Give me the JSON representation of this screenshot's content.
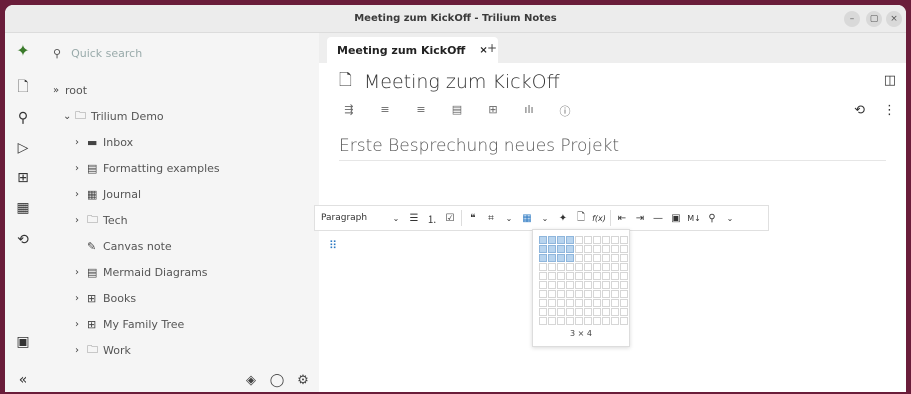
{
  "window": {
    "title": "Meeting zum KickOff - Trilium Notes",
    "controls": {
      "minimize": "–",
      "maximize": "▢",
      "close": "×"
    }
  },
  "launcher": {
    "logo": "✦",
    "new_note": "🗋",
    "search": "⚲",
    "jump": "▷",
    "map": "⊞",
    "calendar": "▦",
    "history": "⟲",
    "today": "▣",
    "collapse": "«"
  },
  "search": {
    "placeholder": "Quick search",
    "icon": "⚲"
  },
  "tree": {
    "root": {
      "label": "root",
      "arrow": "»"
    },
    "items": [
      {
        "label": "Trilium Demo",
        "arrow": "⌄",
        "icon": "🗀"
      },
      {
        "label": "Inbox",
        "arrow": "›",
        "icon": "▬"
      },
      {
        "label": "Formatting examples",
        "arrow": "›",
        "icon": "▤"
      },
      {
        "label": "Journal",
        "arrow": "›",
        "icon": "▦"
      },
      {
        "label": "Tech",
        "arrow": "›",
        "icon": "🗀"
      },
      {
        "label": "Canvas note",
        "arrow": "",
        "icon": "✎"
      },
      {
        "label": "Mermaid Diagrams",
        "arrow": "›",
        "icon": "▤"
      },
      {
        "label": "Books",
        "arrow": "›",
        "icon": "⊞"
      },
      {
        "label": "My Family Tree",
        "arrow": "›",
        "icon": "⊞"
      },
      {
        "label": "Work",
        "arrow": "›",
        "icon": "🗀"
      }
    ],
    "footer": {
      "layers": "◈",
      "sync": "◯",
      "settings": "⚙"
    }
  },
  "tabs": [
    {
      "label": "Meeting zum KickOff",
      "close": "×"
    }
  ],
  "new_tab": "+",
  "note": {
    "title": "Meeting zum KickOff",
    "title_icon": "🗋",
    "side_toggle": "◫",
    "heading": "Erste Besprechung neues Projekt",
    "ribbon": [
      "⇶",
      "≡",
      "≡",
      "▤",
      "⊞",
      "ılı",
      "ⓘ"
    ],
    "ribbon_right": {
      "history": "⟲",
      "menu": "⋮"
    }
  },
  "format_toolbar": {
    "heading_select": "Paragraph",
    "dropdown": "⌄",
    "buttons": {
      "bullet_list": "☰",
      "numbered_list": "⒈",
      "todo_list": "☑",
      "quote": "❝",
      "code_block": "⌗",
      "code_dd": "⌄",
      "table": "▦",
      "table_dd": "⌄",
      "include_note": "✦",
      "note_link": "🗋",
      "math": "f(x)",
      "outdent": "⇤",
      "indent": "⇥",
      "hr": "—",
      "image": "▣",
      "markdown": "M↓",
      "find": "⚲",
      "find_dd": "⌄"
    },
    "block_handle": "⠿"
  },
  "table_picker": {
    "selected_rows": 3,
    "selected_cols": 4,
    "label": "3 × 4"
  },
  "colors": {
    "accent": "#2a78c2",
    "desktop": "#6a1d3a",
    "sidebar": "#f5f5f5"
  }
}
